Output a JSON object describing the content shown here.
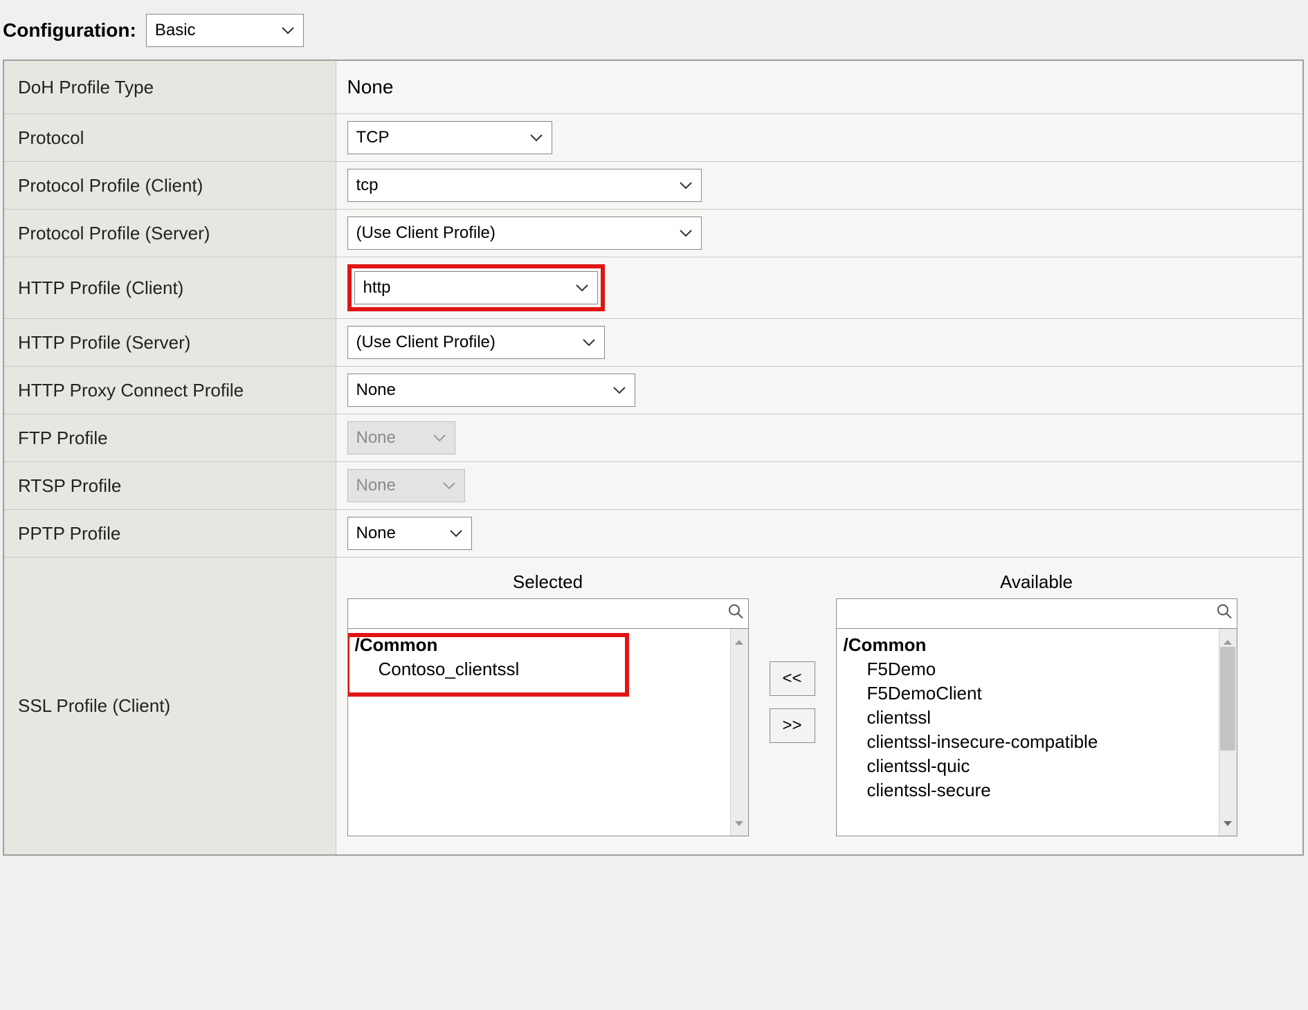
{
  "header": {
    "configuration_label": "Configuration:",
    "configuration_value": "Basic"
  },
  "rows": {
    "doh_profile_type": {
      "label": "DoH Profile Type",
      "value": "None"
    },
    "protocol": {
      "label": "Protocol",
      "value": "TCP"
    },
    "protocol_profile_client": {
      "label": "Protocol Profile (Client)",
      "value": "tcp"
    },
    "protocol_profile_server": {
      "label": "Protocol Profile (Server)",
      "value": "(Use Client Profile)"
    },
    "http_profile_client": {
      "label": "HTTP Profile (Client)",
      "value": "http"
    },
    "http_profile_server": {
      "label": "HTTP Profile (Server)",
      "value": "(Use Client Profile)"
    },
    "http_proxy_connect": {
      "label": "HTTP Proxy Connect Profile",
      "value": "None"
    },
    "ftp_profile": {
      "label": "FTP Profile",
      "value": "None"
    },
    "rtsp_profile": {
      "label": "RTSP Profile",
      "value": "None"
    },
    "pptp_profile": {
      "label": "PPTP Profile",
      "value": "None"
    },
    "ssl_profile_client": {
      "label": "SSL Profile (Client)"
    }
  },
  "ssl": {
    "selected_title": "Selected",
    "available_title": "Available",
    "group_label": "/Common",
    "selected_items": [
      "Contoso_clientssl"
    ],
    "available_items": [
      "F5Demo",
      "F5DemoClient",
      "clientssl",
      "clientssl-insecure-compatible",
      "clientssl-quic",
      "clientssl-secure"
    ],
    "move_left": "<<",
    "move_right": ">>"
  },
  "widths": {
    "config_select": 228,
    "protocol": 296,
    "protocol_profile_client": 512,
    "protocol_profile_server": 512,
    "http_profile_client": 352,
    "http_profile_server": 372,
    "http_proxy_connect": 416,
    "ftp_profile": 156,
    "rtsp_profile": 170,
    "pptp_profile": 180
  }
}
